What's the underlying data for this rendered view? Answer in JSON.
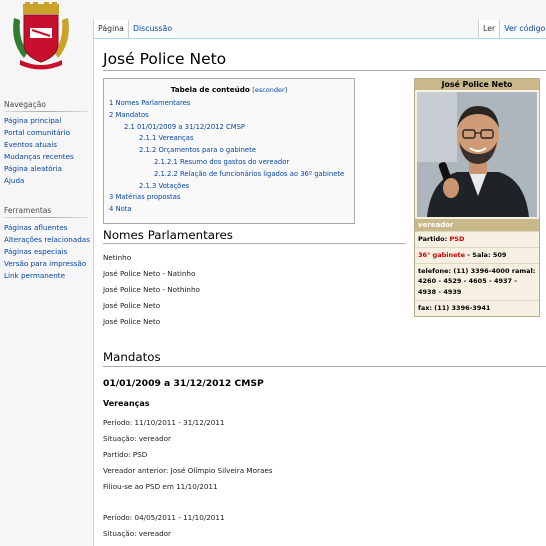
{
  "sidebar": {
    "navigation_heading": "Navegação",
    "navigation_items": [
      {
        "label": "Página principal"
      },
      {
        "label": "Portal comunitário"
      },
      {
        "label": "Eventos atuais"
      },
      {
        "label": "Mudanças recentes"
      },
      {
        "label": "Página aleatória"
      },
      {
        "label": "Ajuda"
      }
    ],
    "tools_heading": "Ferramentas",
    "tools_items": [
      {
        "label": "Páginas afluentes"
      },
      {
        "label": "Alterações relacionadas"
      },
      {
        "label": "Páginas especiais"
      },
      {
        "label": "Versão para impressão"
      },
      {
        "label": "Link permanente"
      }
    ]
  },
  "tabs": {
    "left": [
      {
        "label": "Página"
      },
      {
        "label": "Discussão"
      }
    ],
    "right": [
      {
        "label": "Ler"
      },
      {
        "label": "Ver código-f"
      }
    ]
  },
  "page": {
    "title": "José Police Neto"
  },
  "toc": {
    "title": "Tabela de conteúdo",
    "toggle": "[esconder]",
    "items": [
      {
        "label": "1 Nomes Parlamentares"
      },
      {
        "label": "2 Mandatos"
      },
      {
        "label": "2.1 01/01/2009 a 31/12/2012 CMSP"
      },
      {
        "label": "2.1.1 Vereanças"
      },
      {
        "label": "2.1.2 Orçamentos para o gabinete"
      },
      {
        "label": "2.1.2.1 Resumo dos gastos do vereador"
      },
      {
        "label": "2.1.2.2 Relação de funcionários ligados ao 36º gabinete"
      },
      {
        "label": "2.1.3 Votações"
      },
      {
        "label": "3 Matérias propostas"
      },
      {
        "label": "4 Nota"
      }
    ]
  },
  "infobox": {
    "name": "José Police Neto",
    "role": "vereador",
    "partido_label": "Partido:",
    "partido_value": "PSD",
    "gabinete_value": "36° gabinete",
    "sala_label": "- Sala:",
    "sala_value": "509",
    "telefone": "telefone: (11) 3396-4000 ramal: 4260 - 4529 - 4605 - 4937 - 4938 - 4939",
    "fax": "fax: (11) 3396-3941"
  },
  "sections": {
    "nomes_heading": "Nomes Parlamentares",
    "nomes": [
      "Netinho",
      "José Police Neto - Natinho",
      "José Police Neto - Nothinho",
      "José Police Neto",
      "José Police Neto"
    ],
    "mandatos_heading": "Mandatos",
    "mandato_sub": "01/01/2009 a 31/12/2012 CMSP",
    "vereancas_heading": "Vereanças",
    "vereanca1": [
      "Período: 11/10/2011 - 31/12/2011",
      "Situação: vereador",
      "Partido: PSD",
      "Vereador anterior: José Olímpio Silveira Moraes",
      "Filiou-se ao PSD em 11/10/2011"
    ],
    "vereanca2": [
      "Período: 04/05/2011 - 11/10/2011",
      "Situação: vereador"
    ]
  },
  "colors": {
    "link": "#0645ad",
    "infobox_header": "#c8b88a",
    "party_red": "#cc0000"
  }
}
